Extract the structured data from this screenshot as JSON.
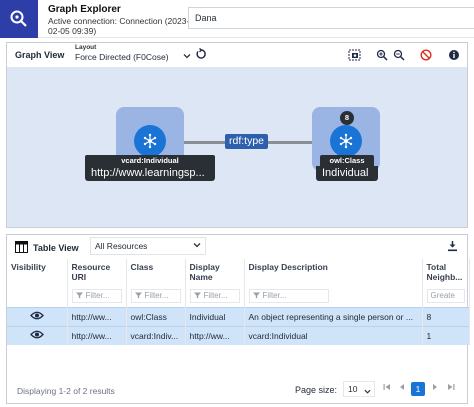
{
  "header": {
    "app_title": "Graph Explorer",
    "connection": "Active connection: Connection (2023-02-05 09:39)",
    "user_name": "Dana"
  },
  "graph_view": {
    "title": "Graph View",
    "layout_caption": "Layout",
    "layout_value": "Force Directed (F0Cose)",
    "nodes": [
      {
        "type_label": "vcard:Individual",
        "display": "http://www.learningsp..."
      },
      {
        "type_label": "owl:Class",
        "display": "Individual",
        "count": "8"
      }
    ],
    "edge_label": "rdf:type"
  },
  "table_view": {
    "title": "Table View",
    "filter_select": "All Resources",
    "columns": [
      "Visibility",
      "Resource URI",
      "Class",
      "Display Name",
      "Display Description",
      "Total Neighb..."
    ],
    "filter_placeholder": "Filter...",
    "last_filter_placeholder": "Greate",
    "rows": [
      {
        "uri": "http://ww...",
        "class": "owl:Class",
        "display_name": "Individual",
        "description": "An object representing a single person or ...",
        "total": "8"
      },
      {
        "uri": "http://ww...",
        "class": "vcard:Indiv...",
        "display_name": "http://ww...",
        "description": "vcard:Individual",
        "total": "1"
      }
    ],
    "footer": {
      "count_text": "Displaying 1-2 of 2 results",
      "page_size_label": "Page size:",
      "page_size": "10",
      "current_page": "1"
    }
  },
  "colors": {
    "accent": "#1a74d6",
    "app_icon_bg": "#2d3ea8",
    "canvas_bg": "#dde6f5",
    "selected_row": "#cfe3f9",
    "danger": "#d92d20"
  }
}
